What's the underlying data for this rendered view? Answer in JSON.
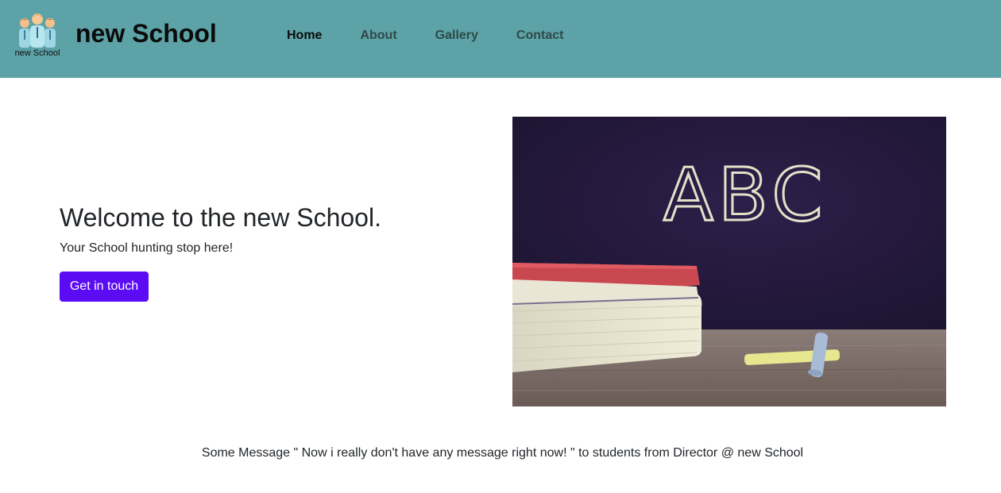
{
  "header": {
    "logo_text": "new School",
    "brand": "new School",
    "background_color": "#5ca2a6"
  },
  "nav": {
    "items": [
      {
        "label": "Home",
        "active": true
      },
      {
        "label": "About",
        "active": false
      },
      {
        "label": "Gallery",
        "active": false
      },
      {
        "label": "Contact",
        "active": false
      }
    ]
  },
  "hero": {
    "title": "Welcome to the new School.",
    "subtitle": "Your School hunting stop here!",
    "cta_label": "Get in touch",
    "cta_color": "#5b0cf5",
    "image": {
      "chalkboard_text": "ABC",
      "icon": "chalkboard-books-image"
    }
  },
  "footer": {
    "message": "Some Message \" Now i really don't have any message right now! \" to students from Director @ new School"
  }
}
